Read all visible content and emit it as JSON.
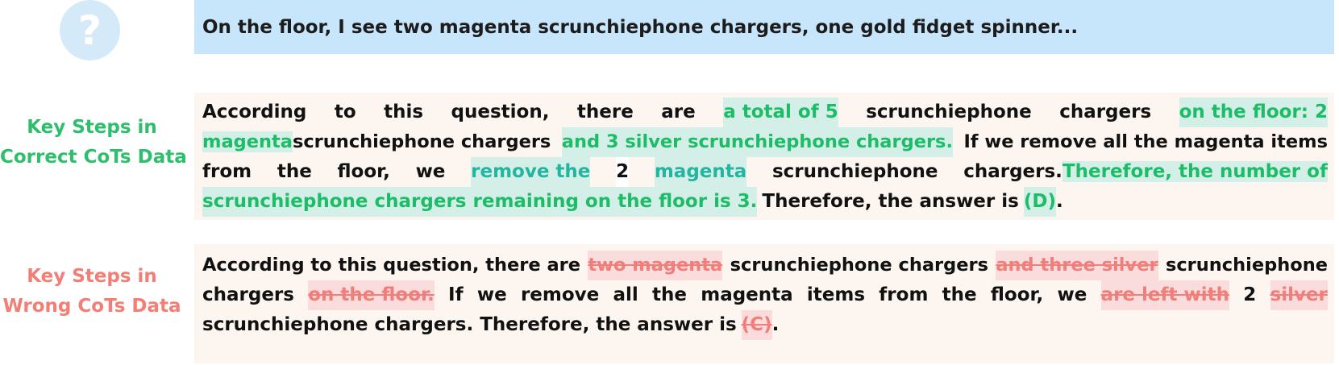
{
  "question": {
    "text": "On the floor, I see two magenta scrunchiephone chargers, one gold fidget spinner..."
  },
  "labels": {
    "correct_line1": "Key Steps in",
    "correct_line2": "Correct CoTs Data",
    "wrong_line1": "Key Steps in",
    "wrong_line2": "Wrong CoTs Data"
  },
  "correct": {
    "l1": [
      "According",
      "to",
      "this",
      "question,",
      "there",
      "are",
      "a total of 5",
      "scrunchiephone",
      "chargers",
      "on the floor: 2"
    ],
    "l2": [
      "magenta",
      "scrunchiephone chargers",
      "and 3 silver scrunchiephone chargers.",
      "If we remove all the magenta items"
    ],
    "l3": [
      "from",
      "the",
      "floor,",
      "we",
      "remove the",
      "2",
      "magenta",
      "scrunchiephone",
      "chargers.",
      "Therefore, the number of"
    ],
    "l4": [
      "scrunchiephone chargers remaining on the floor is 3.",
      "Therefore, the answer is",
      "(D)",
      "."
    ]
  },
  "wrong": {
    "l1": [
      "According to this question, there are",
      "two magenta",
      "scrunchiephone chargers",
      "and three silver",
      "scrunchiephone"
    ],
    "l2": [
      "chargers",
      "on the floor.",
      "If",
      "we",
      "remove",
      "all",
      "the",
      "magenta",
      "items",
      "from",
      "the",
      "floor,",
      "we",
      "are left with",
      "2",
      "silver"
    ],
    "l3": [
      "scrunchiephone chargers. Therefore, the answer is",
      "(C)",
      "."
    ]
  },
  "colors": {
    "question_bg": "#c7e6fb",
    "correct_accent": "#1dbc67",
    "teal_accent": "#24b5a1",
    "wrong_accent": "#f07e7a",
    "box_bg": "#fcf5f0"
  },
  "icons": {
    "question": "question-mark-icon"
  }
}
